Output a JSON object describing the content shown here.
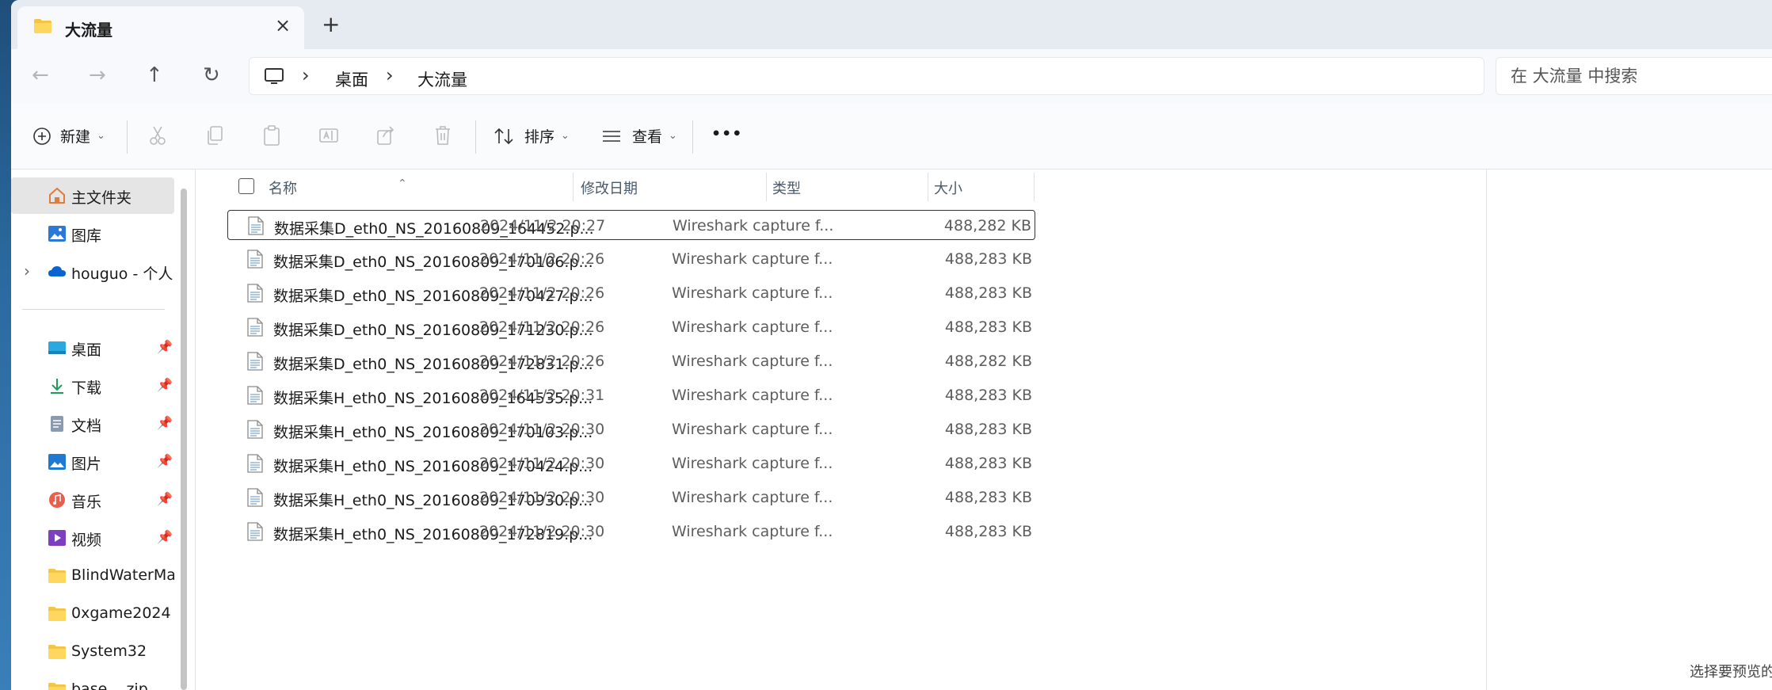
{
  "tab": {
    "title": "大流量",
    "close": "×",
    "new_tab": "+"
  },
  "nav": {
    "back": "←",
    "forward": "→",
    "up": "↑",
    "refresh": "↻"
  },
  "address": {
    "crumbs": [
      "桌面",
      "大流量"
    ],
    "sep": "›"
  },
  "search": {
    "placeholder": "在 大流量 中搜索"
  },
  "commands": {
    "new_label": "新建",
    "sort_label": "排序",
    "view_label": "查看",
    "more": "•••",
    "chev": "⌄"
  },
  "sidebar": {
    "items": [
      {
        "label": "主文件夹",
        "icon": "home-icon"
      },
      {
        "label": "图库",
        "icon": "gallery-icon"
      },
      {
        "label": "houguo - 个人",
        "icon": "onedrive-icon"
      },
      {
        "label": "桌面",
        "icon": "desktop-icon"
      },
      {
        "label": "下载",
        "icon": "download-icon"
      },
      {
        "label": "文档",
        "icon": "document-icon"
      },
      {
        "label": "图片",
        "icon": "pictures-icon"
      },
      {
        "label": "音乐",
        "icon": "music-icon"
      },
      {
        "label": "视频",
        "icon": "video-icon"
      },
      {
        "label": "BlindWaterMark",
        "icon": "folder-icon"
      },
      {
        "label": "0xgame2024",
        "icon": "folder-icon"
      },
      {
        "label": "System32",
        "icon": "folder-icon"
      },
      {
        "label": "base....zip",
        "icon": "folder-icon"
      }
    ]
  },
  "columns": {
    "name": "名称",
    "date": "修改日期",
    "type": "类型",
    "size": "大小"
  },
  "files": [
    {
      "name": "数据采集D_eth0_NS_20160809_164452.p...",
      "date": "2024/11/2 20:27",
      "type": "Wireshark capture f...",
      "size": "488,282 KB"
    },
    {
      "name": "数据采集D_eth0_NS_20160809_170106.p...",
      "date": "2024/11/2 20:26",
      "type": "Wireshark capture f...",
      "size": "488,283 KB"
    },
    {
      "name": "数据采集D_eth0_NS_20160809_170427.p...",
      "date": "2024/11/2 20:26",
      "type": "Wireshark capture f...",
      "size": "488,283 KB"
    },
    {
      "name": "数据采集D_eth0_NS_20160809_171230.p...",
      "date": "2024/11/2 20:26",
      "type": "Wireshark capture f...",
      "size": "488,283 KB"
    },
    {
      "name": "数据采集D_eth0_NS_20160809_172831.p...",
      "date": "2024/11/2 20:26",
      "type": "Wireshark capture f...",
      "size": "488,282 KB"
    },
    {
      "name": "数据采集H_eth0_NS_20160809_164535.p...",
      "date": "2024/11/2 20:31",
      "type": "Wireshark capture f...",
      "size": "488,283 KB"
    },
    {
      "name": "数据采集H_eth0_NS_20160809_170103.p...",
      "date": "2024/11/2 20:30",
      "type": "Wireshark capture f...",
      "size": "488,283 KB"
    },
    {
      "name": "数据采集H_eth0_NS_20160809_170424.p...",
      "date": "2024/11/2 20:30",
      "type": "Wireshark capture f...",
      "size": "488,283 KB"
    },
    {
      "name": "数据采集H_eth0_NS_20160809_170930.p...",
      "date": "2024/11/2 20:30",
      "type": "Wireshark capture f...",
      "size": "488,283 KB"
    },
    {
      "name": "数据采集H_eth0_NS_20160809_172819.p...",
      "date": "2024/11/2 20:30",
      "type": "Wireshark capture f...",
      "size": "488,283 KB"
    }
  ],
  "preview": {
    "message": "选择要预览的文件。"
  }
}
